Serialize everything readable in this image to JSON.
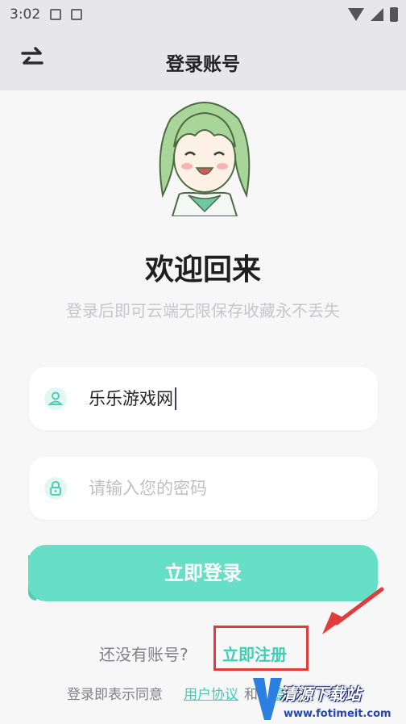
{
  "status_bar": {
    "time": "3:02"
  },
  "header": {
    "title": "登录账号",
    "swap_icon": "swap-arrows-icon"
  },
  "welcome": {
    "title": "欢迎回来",
    "subtitle": "登录后即可云端无限保存收藏永不丢失"
  },
  "form": {
    "username": {
      "value": "乐乐游戏网",
      "icon": "user-icon"
    },
    "password": {
      "placeholder": "请输入您的密码",
      "icon": "lock-icon"
    },
    "login_label": "立即登录"
  },
  "register": {
    "prompt": "还没有账号?",
    "link": "立即注册"
  },
  "agreement": {
    "prefix": "登录即表示同意",
    "user_agreement": "用户协议",
    "and": "和",
    "privacy": "隐"
  },
  "watermark": {
    "name": "清源下载站",
    "url": "www.fotimeit.com"
  },
  "colors": {
    "accent": "#67dfc7",
    "link": "#3ecfb3",
    "highlight": "#e23b3b"
  }
}
